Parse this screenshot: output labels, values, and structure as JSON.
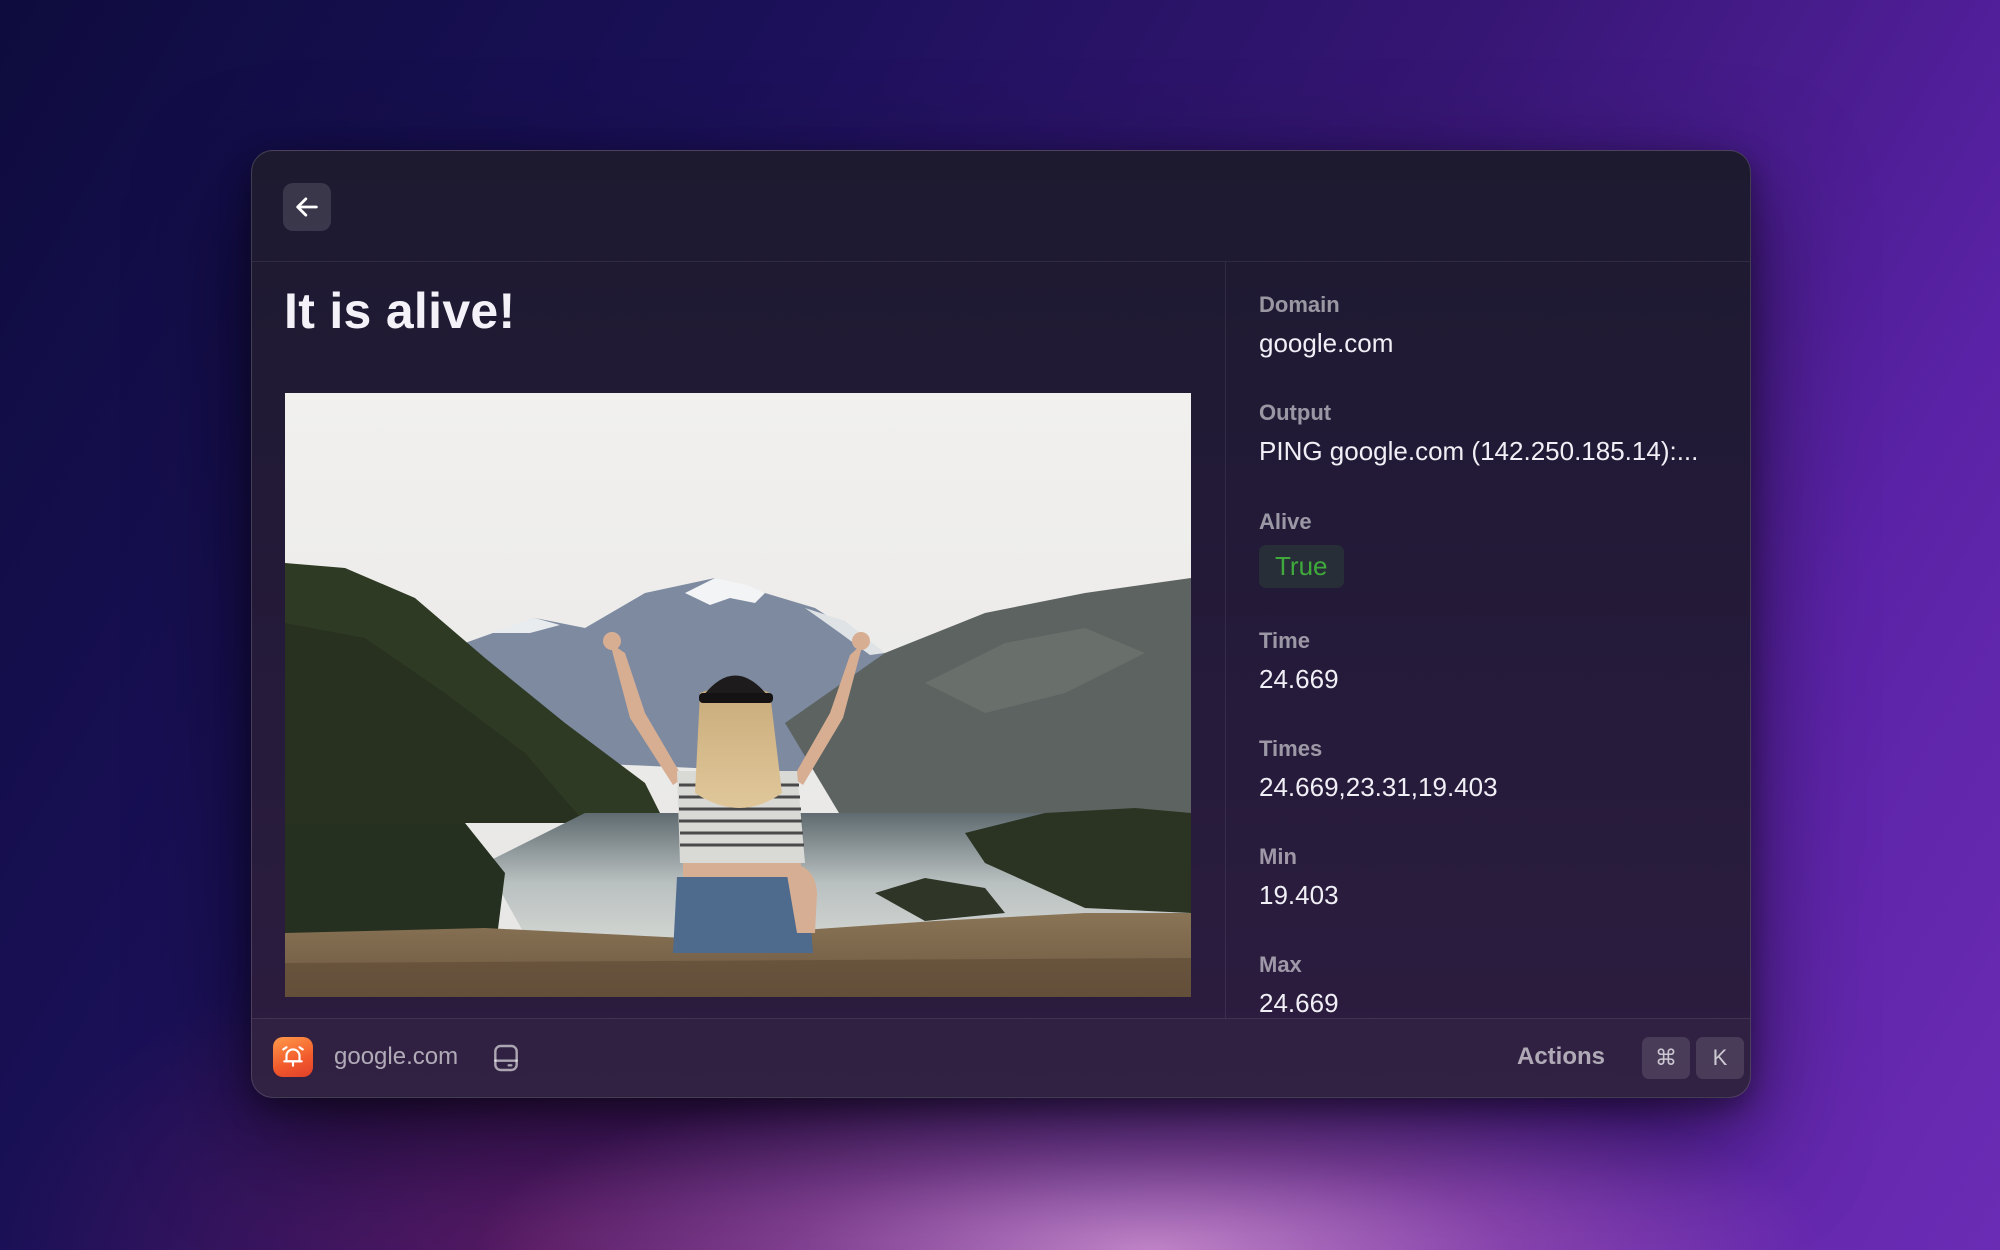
{
  "topbar": {
    "back_icon": "arrow-left-icon"
  },
  "detail": {
    "title": "It is alive!",
    "image": {
      "icon": "photo-woman-mountain-lake"
    }
  },
  "metadata": [
    {
      "label": "Domain",
      "value": "google.com"
    },
    {
      "label": "Output",
      "value": "PING google.com (142.250.185.14):..."
    },
    {
      "label": "Alive",
      "value": "True",
      "tag_color": "#3faa3b"
    },
    {
      "label": "Time",
      "value": "24.669"
    },
    {
      "label": "Times",
      "value": "24.669,23.31,19.403"
    },
    {
      "label": "Min",
      "value": "19.403"
    },
    {
      "label": "Max",
      "value": "24.669"
    }
  ],
  "footer": {
    "app_icon": "alarm-bell-icon",
    "title": "google.com",
    "secondary_icon": "hard-drive-icon",
    "actions_label": "Actions",
    "shortcut_keys": [
      "⌘",
      "K"
    ]
  },
  "colors": {
    "accent_orange": "#f25a2c",
    "badge_green": "#3faa3b"
  }
}
